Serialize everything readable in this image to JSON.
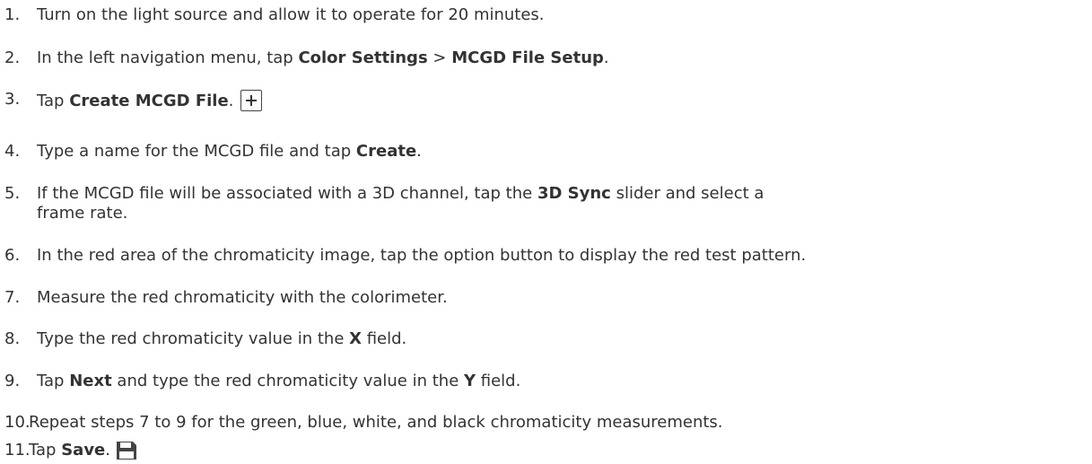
{
  "steps": [
    {
      "num": "1.",
      "parts": [
        {
          "t": "Turn on the light source and allow it to operate for 20 minutes."
        }
      ]
    },
    {
      "num": "2.",
      "parts": [
        {
          "t": "In the left navigation menu, tap "
        },
        {
          "t": "Color Settings",
          "b": true
        },
        {
          "t": " > "
        },
        {
          "t": "MCGD File Setup",
          "b": true
        },
        {
          "t": "."
        }
      ]
    },
    {
      "num": "3.",
      "parts": [
        {
          "t": "Tap "
        },
        {
          "t": "Create MCGD File",
          "b": true
        },
        {
          "t": "."
        }
      ],
      "icon": "plus-icon"
    },
    {
      "num": "4.",
      "parts": [
        {
          "t": "Type a name for the MCGD file and tap "
        },
        {
          "t": "Create",
          "b": true
        },
        {
          "t": "."
        }
      ]
    },
    {
      "num": "5.",
      "parts": [
        {
          "t": "If the MCGD file will be associated with a 3D channel, tap the "
        },
        {
          "t": "3D Sync",
          "b": true
        },
        {
          "t": " slider and select a frame rate."
        }
      ]
    },
    {
      "num": "6.",
      "parts": [
        {
          "t": "In the red area of the chromaticity image, tap the option button to display the red test pattern."
        }
      ]
    },
    {
      "num": "7.",
      "parts": [
        {
          "t": "Measure the red chromaticity with the colorimeter."
        }
      ]
    },
    {
      "num": "8.",
      "parts": [
        {
          "t": "Type the red chromaticity value in the "
        },
        {
          "t": "X",
          "b": true
        },
        {
          "t": " field."
        }
      ]
    },
    {
      "num": "9.",
      "parts": [
        {
          "t": "Tap "
        },
        {
          "t": "Next",
          "b": true
        },
        {
          "t": " and type the red chromaticity value in the "
        },
        {
          "t": "Y",
          "b": true
        },
        {
          "t": " field."
        }
      ]
    },
    {
      "num": "10.",
      "parts": [
        {
          "t": "Repeat steps 7 to 9 for the green, blue, white, and black chromaticity measurements."
        }
      ]
    },
    {
      "num": "11.",
      "parts": [
        {
          "t": "Tap "
        },
        {
          "t": "Save",
          "b": true
        },
        {
          "t": "."
        }
      ],
      "icon": "save-icon"
    }
  ],
  "step5_line2": "frame rate."
}
